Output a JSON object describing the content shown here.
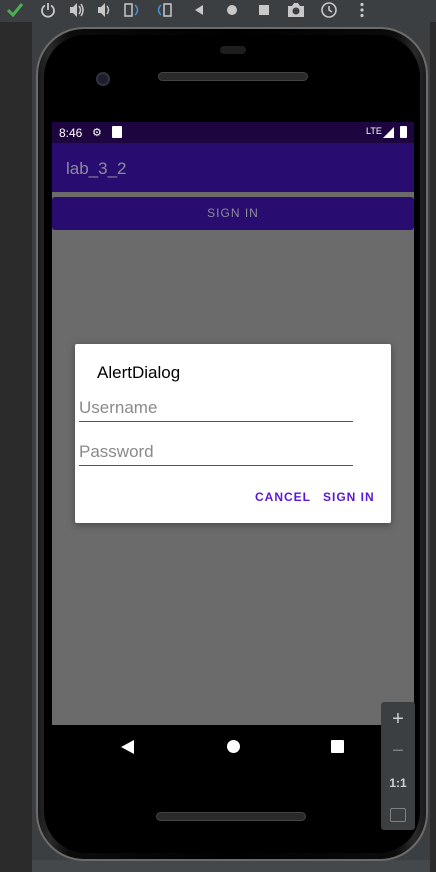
{
  "emulator": {
    "toolbar_icons": [
      "check-icon",
      "power-icon",
      "volume-up-icon",
      "volume-down-icon",
      "rotate-left-icon",
      "rotate-right-icon",
      "back-icon",
      "home-icon",
      "overview-icon",
      "camera-icon",
      "replay-icon",
      "more-icon"
    ],
    "zoom": {
      "plus": "+",
      "minus": "−",
      "one_to_one": "1:1"
    }
  },
  "statusbar": {
    "time": "8:46",
    "network": "LTE"
  },
  "app": {
    "title": "lab_3_2",
    "signin_button": "SIGN IN"
  },
  "dialog": {
    "title": "AlertDialog",
    "username_placeholder": "Username",
    "password_placeholder": "Password",
    "cancel_label": "CANCEL",
    "signin_label": "SIGN IN"
  },
  "colors": {
    "status_bar": "#1d0640",
    "app_bar": "#290c70",
    "dialog_accent": "#5a18d6",
    "screen_dim": "#6b6b6b"
  }
}
